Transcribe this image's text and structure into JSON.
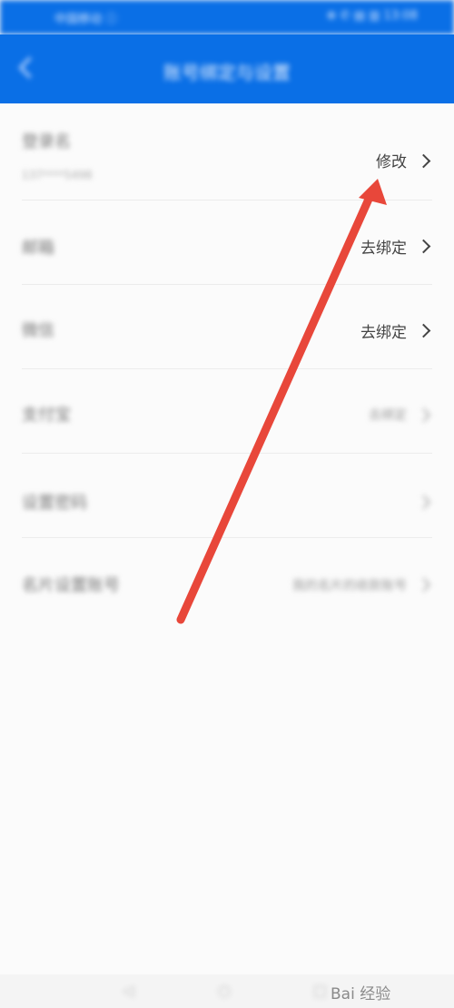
{
  "statusbar": {
    "left": "中国移动 ⓘ",
    "right": "⊕ ✆ ▤ ▥ 13:08"
  },
  "navbar": {
    "title": "账号绑定与设置"
  },
  "rows": [
    {
      "label": "登录名",
      "sub": "137****5498",
      "action": "修改"
    },
    {
      "label": "邮箱",
      "action": "去绑定"
    },
    {
      "label": "微信",
      "action": "去绑定"
    },
    {
      "label": "支付宝",
      "action": "去绑定"
    },
    {
      "label": "设置密码",
      "action": ""
    },
    {
      "label": "名片设置账号",
      "action": "我的名片的收款账号"
    }
  ],
  "watermark": "Bai 经验",
  "colors": {
    "primary": "#0a6fe6",
    "arrow": "#e8473a"
  }
}
